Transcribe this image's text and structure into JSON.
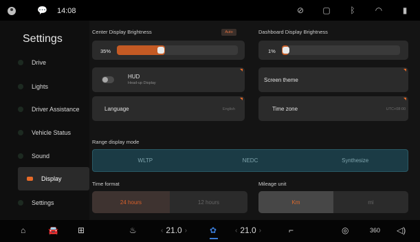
{
  "status_bar": {
    "time": "14:08",
    "icons": [
      "user-icon",
      "chat-icon",
      "no-signal-icon",
      "screen-icon",
      "bluetooth-icon",
      "wifi-icon",
      "cell-signal-icon"
    ]
  },
  "sidebar": {
    "title": "Settings",
    "items": [
      {
        "label": "Drive"
      },
      {
        "label": "Lights"
      },
      {
        "label": "Driver Assistance"
      },
      {
        "label": "Vehicle Status"
      },
      {
        "label": "Sound"
      },
      {
        "label": "Display",
        "active": true
      },
      {
        "label": "Settings"
      }
    ]
  },
  "center_display": {
    "label": "Center Display Brightness",
    "auto_label": "Auto",
    "value_text": "35%",
    "value": 0.35
  },
  "dashboard_display": {
    "label": "Dashboard Display Brightness",
    "value_text": "1%",
    "value": 0.01
  },
  "hud": {
    "title": "HUD",
    "subtitle": "Head-up Display",
    "enabled": false
  },
  "screen_theme": {
    "label": "Screen theme"
  },
  "language": {
    "label": "Language",
    "value": "English"
  },
  "time_zone": {
    "label": "Time zone",
    "value": "UTC+08:00"
  },
  "range_mode": {
    "label": "Range display mode",
    "options": [
      "WLTP",
      "NEDC",
      "Synthesize"
    ]
  },
  "time_format": {
    "label": "Time format",
    "options": [
      "24 hours",
      "12 hours"
    ],
    "selected": "24 hours"
  },
  "mileage_unit": {
    "label": "Mileage unit",
    "options": [
      "Km",
      "mi"
    ],
    "selected": "Km"
  },
  "dock": {
    "left_temp": "21.0",
    "right_temp": "21.0",
    "auto_climate_label": "360",
    "icons": [
      "home-icon",
      "car-icon",
      "apps-icon",
      "heated-steering-icon",
      "fan-icon",
      "seat-heat-icon",
      "drive-mode-icon",
      "auto-climate-icon",
      "volume-icon"
    ]
  },
  "colors": {
    "accent": "#e66a28",
    "fan_accent": "#3a7bd5",
    "range_bg": "#1b3b45"
  }
}
